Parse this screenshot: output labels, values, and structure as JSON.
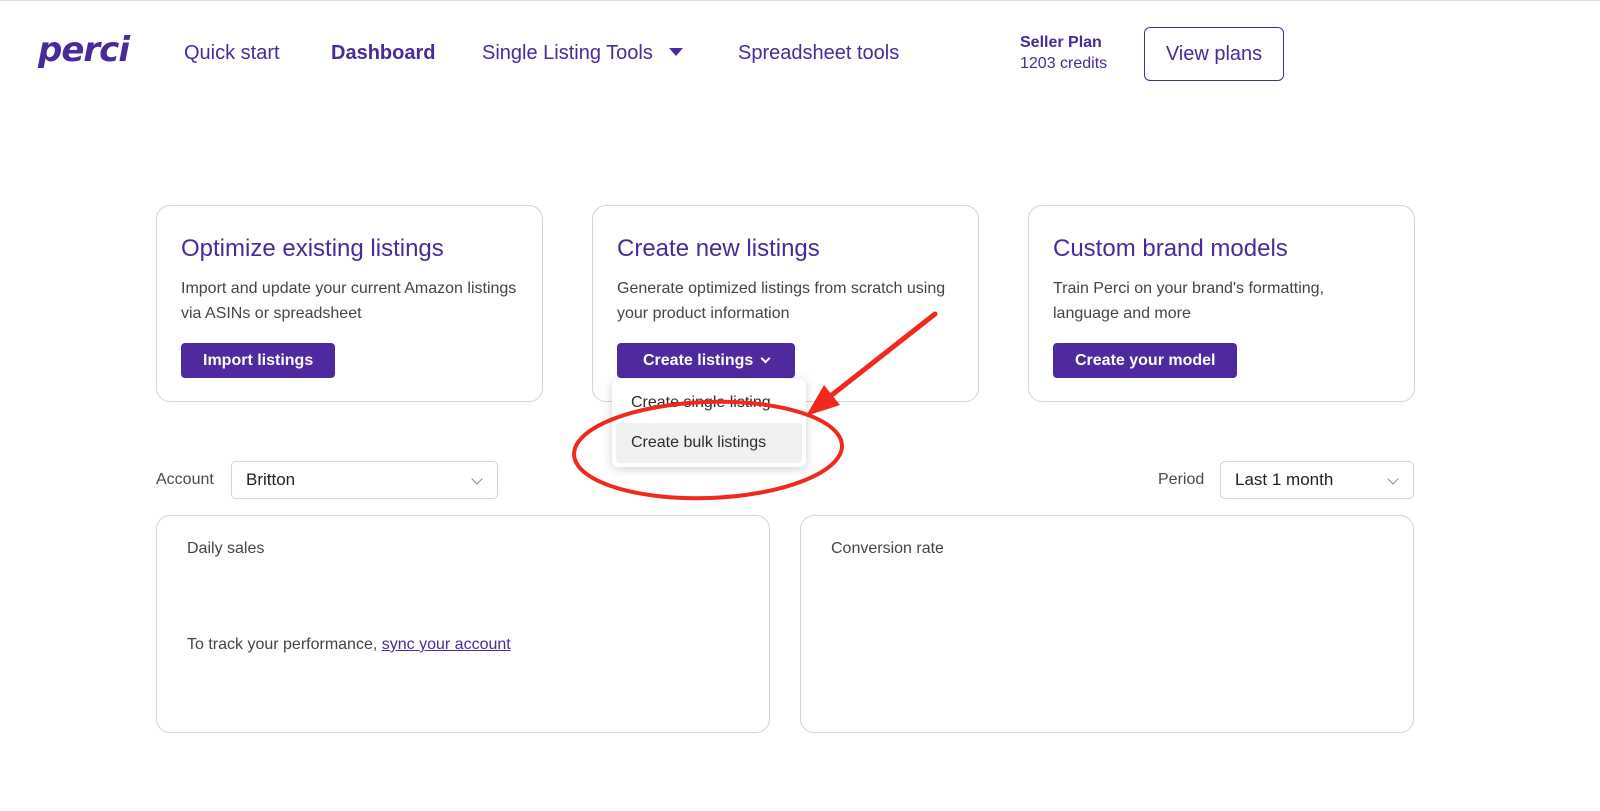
{
  "header": {
    "logo": "perci",
    "nav": [
      {
        "label": "Quick start"
      },
      {
        "label": "Dashboard"
      },
      {
        "label": "Single Listing Tools"
      },
      {
        "label": "Spreadsheet tools"
      }
    ],
    "plan_name": "Seller Plan",
    "credits": "1203 credits",
    "view_plans_label": "View plans"
  },
  "cards": [
    {
      "title": "Optimize existing listings",
      "description": "Import and update your current Amazon listings via ASINs or spreadsheet",
      "button_label": "Import listings"
    },
    {
      "title": "Create new listings",
      "description": "Generate optimized listings from scratch using your product information",
      "button_label": "Create listings"
    },
    {
      "title": "Custom brand models",
      "description": "Train Perci on your brand's formatting, language and more",
      "button_label": "Create your model"
    }
  ],
  "dropdown": {
    "items": [
      "Create single listing",
      "Create bulk listings"
    ]
  },
  "filters": {
    "account_label": "Account",
    "account_value": "Britton",
    "period_label": "Period",
    "period_value": "Last 1 month"
  },
  "panels": {
    "daily_sales_title": "Daily sales",
    "track_text": "To track your performance, ",
    "sync_link": "sync your account",
    "conversion_title": "Conversion rate"
  },
  "colors": {
    "brand": "#4a2a9b",
    "button": "#4e2a9e",
    "annotation": "#f0281e"
  },
  "icons": [
    "caret-down-icon",
    "chevron-down-icon",
    "annotation-arrow",
    "annotation-ellipse"
  ]
}
